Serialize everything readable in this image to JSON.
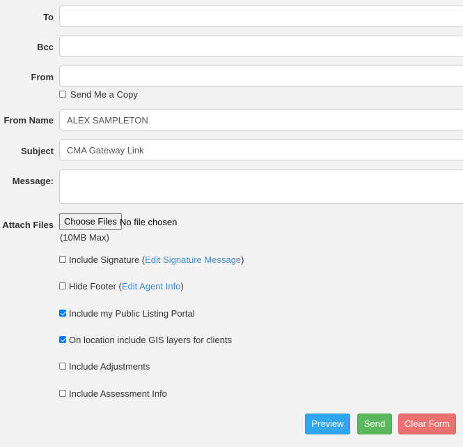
{
  "fields": {
    "to": {
      "label": "To",
      "value": ""
    },
    "bcc": {
      "label": "Bcc",
      "value": ""
    },
    "from": {
      "label": "From",
      "value": ""
    },
    "send_copy": {
      "label": "Send Me a Copy",
      "checked": false
    },
    "from_name": {
      "label": "From Name",
      "value": "ALEX SAMPLETON"
    },
    "subject": {
      "label": "Subject",
      "value": "CMA Gateway Link"
    },
    "message": {
      "label": "Message:",
      "value": ""
    }
  },
  "attach": {
    "label": "Attach Files",
    "button": "Choose Files",
    "status": "No file chosen",
    "note": "(10MB Max)"
  },
  "options": {
    "signature": {
      "text": "Include Signature (",
      "link": "Edit Signature Message",
      "after": ")",
      "checked": false
    },
    "footer": {
      "text": "Hide Footer (",
      "link": "Edit Agent Info",
      "after": ")",
      "checked": false
    },
    "portal": {
      "text": "Include my Public Listing Portal",
      "checked": true
    },
    "gis": {
      "text": "On location include GIS layers for clients",
      "checked": true
    },
    "adjustments": {
      "text": "Include Adjustments",
      "checked": false
    },
    "assessment": {
      "text": "Include Assessment Info",
      "checked": false
    }
  },
  "buttons": {
    "preview": "Preview",
    "send": "Send",
    "clear": "Clear Form"
  },
  "colors": {
    "preview": "#32a7f0",
    "send": "#5cb85c",
    "clear": "#ec7170",
    "link": "#428bca",
    "checkbox": "#0075ff"
  }
}
